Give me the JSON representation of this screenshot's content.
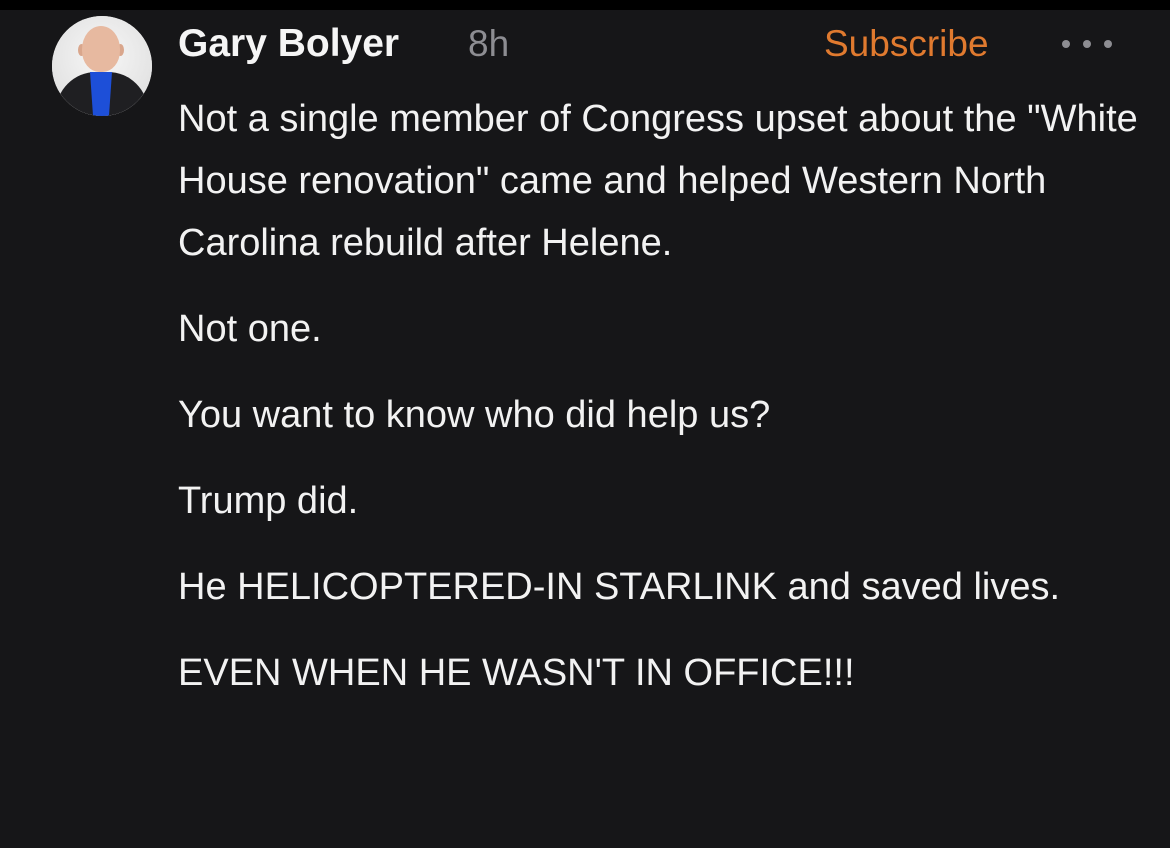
{
  "comment": {
    "author": "Gary Bolyer",
    "timestamp": "8h",
    "subscribe_label": "Subscribe",
    "paragraphs": [
      "Not a single member of Congress upset about the \"White House renovation\" came and helped Western North Carolina rebuild after Helene.",
      "Not one.",
      "You want to know who did help us?",
      "Trump did.",
      "He HELICOPTERED-IN STARLINK and saved lives.",
      "EVEN WHEN HE WASN'T IN OFFICE!!!"
    ]
  },
  "icons": {
    "more": "more-options-icon",
    "avatar": "user-avatar"
  },
  "colors": {
    "background": "#161618",
    "text": "#f2f2f2",
    "muted": "#8d8d92",
    "accent": "#e07a2f"
  }
}
